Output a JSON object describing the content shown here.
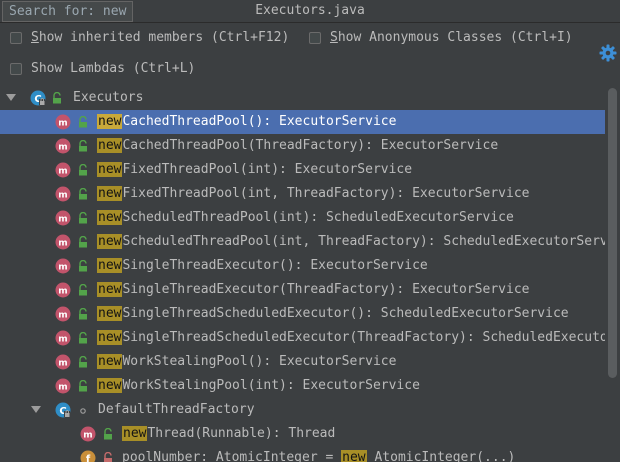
{
  "header": {
    "search_prefix": "Search for: ",
    "search_query": "new",
    "title": "Executors.java"
  },
  "options": {
    "show_inherited": {
      "mnemonic": "S",
      "rest": "how inherited members (Ctrl+F12)",
      "checked": false
    },
    "show_anonymous": {
      "mnemonic": "S",
      "rest": "how Anonymous Classes (Ctrl+I)",
      "checked": false
    },
    "show_lambdas": {
      "label": "Show Lambdas (Ctrl+L)",
      "checked": false
    }
  },
  "tree": {
    "root": {
      "name": "Executors",
      "expanded": true,
      "icon": "class-icon"
    },
    "methods": [
      {
        "match": "new",
        "rest": "CachedThreadPool(): ExecutorService",
        "selected": true
      },
      {
        "match": "new",
        "rest": "CachedThreadPool(ThreadFactory): ExecutorService"
      },
      {
        "match": "new",
        "rest": "FixedThreadPool(int): ExecutorService"
      },
      {
        "match": "new",
        "rest": "FixedThreadPool(int, ThreadFactory): ExecutorService"
      },
      {
        "match": "new",
        "rest": "ScheduledThreadPool(int): ScheduledExecutorService"
      },
      {
        "match": "new",
        "rest": "ScheduledThreadPool(int, ThreadFactory): ScheduledExecutorServ"
      },
      {
        "match": "new",
        "rest": "SingleThreadExecutor(): ExecutorService"
      },
      {
        "match": "new",
        "rest": "SingleThreadExecutor(ThreadFactory): ExecutorService"
      },
      {
        "match": "new",
        "rest": "SingleThreadScheduledExecutor(): ScheduledExecutorService"
      },
      {
        "match": "new",
        "rest": "SingleThreadScheduledExecutor(ThreadFactory): ScheduledExecuto"
      },
      {
        "match": "new",
        "rest": "WorkStealingPool(): ExecutorService"
      },
      {
        "match": "new",
        "rest": "WorkStealingPool(int): ExecutorService"
      }
    ],
    "inner_class": {
      "name": "DefaultThreadFactory",
      "expanded": true
    },
    "inner_method": {
      "match": "new",
      "rest": "Thread(Runnable): Thread"
    },
    "field_row": {
      "prefix": "poolNumber: AtomicInteger = ",
      "match": "new",
      "rest": " AtomicInteger(...)"
    }
  },
  "colors": {
    "background": "#3c3f41",
    "selection": "#4b6eaf",
    "match_highlight": "#a88f27",
    "method_icon": "#c2546b",
    "class_icon": "#2f8ec7",
    "lock_icon": "#53a34a"
  }
}
